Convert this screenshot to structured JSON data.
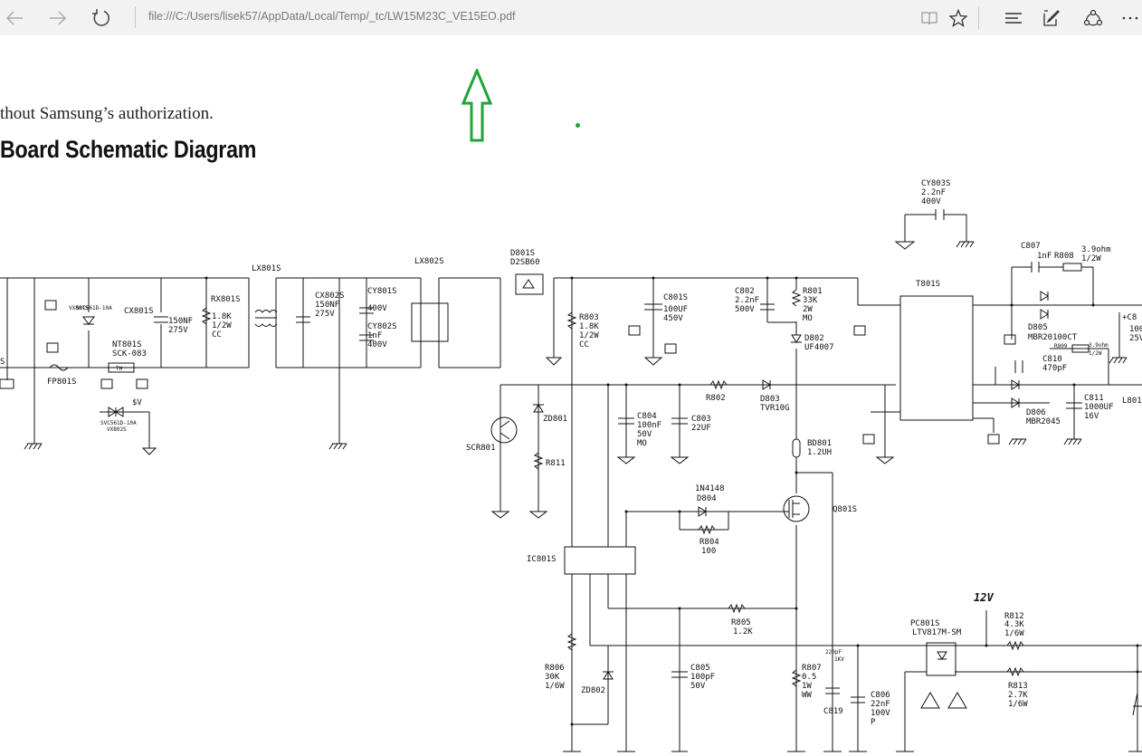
{
  "browser": {
    "url": "file:///C:/Users/lisek57/AppData/Local/Temp/_tc/LW15M23C_VE15EO.pdf",
    "icons": [
      "back-icon",
      "forward-icon",
      "refresh-icon",
      "reading-view-icon",
      "favorite-star-icon",
      "hub-icon",
      "web-note-icon",
      "share-icon",
      "more-icon"
    ]
  },
  "document": {
    "authorization_text": "thout Samsung’s authorization.",
    "heading": "Board Schematic Diagram"
  },
  "annotation": {
    "arrow_color": "#1fa535"
  },
  "schematic": {
    "labels": [
      "LX801S",
      "LX802S",
      "D801S",
      "D2SB60",
      "CY803S",
      "2.2nF",
      "400V",
      "C807",
      "1nF",
      "R808",
      "3.9ohm",
      "1/2W",
      "T801S",
      "CX801S",
      "150NF",
      "275V",
      "RX801S",
      "1.8K",
      "1/2W",
      "CC",
      "CX802S",
      "150NF",
      "275V",
      "CY801S",
      "400V",
      "CY802S",
      "1nF",
      "400V",
      "R803",
      "1.8K",
      "1/2W",
      "CC",
      "C801S",
      "100UF",
      "450V",
      "C802",
      "2.2nF",
      "500V",
      "R801",
      "33K",
      "2W",
      "MO",
      "D802",
      "UF4007",
      "D805",
      "MBR20100CT",
      "R809",
      "3.9ohm",
      "1/2W",
      "C810",
      "470pF",
      "C811",
      "1000UF",
      "16V",
      "D806",
      "MBR2045",
      "VX801S",
      "SVC561D-10A",
      "NT801S",
      "SCK-083",
      "TH",
      "FP801S",
      "$V",
      "SVC561D-10A",
      "VX802S",
      "R802",
      "D803",
      "TVR10G",
      "ZD801",
      "C804",
      "100nF",
      "50V",
      "MO",
      "C803",
      "22UF",
      "SCR801",
      "R811",
      "BD801",
      "1.2UH",
      "1N4148",
      "D804",
      "R804",
      "100",
      "Q801S",
      "IC801S",
      "R805",
      "1.2K",
      "12V",
      "PC801S",
      "LTV817M-SM",
      "R812",
      "4.3K",
      "1/6W",
      "R813",
      "2.7K",
      "1/6W",
      "R806",
      "30K",
      "1/6W",
      "ZD802",
      "C805",
      "100pF",
      "50V",
      "R807",
      "0.5",
      "1W",
      "WW",
      "220pF",
      "1KV",
      "C819",
      "C806",
      "22nF",
      "100V",
      "P",
      "L801",
      "S",
      "+C8",
      "100",
      "25V"
    ]
  }
}
